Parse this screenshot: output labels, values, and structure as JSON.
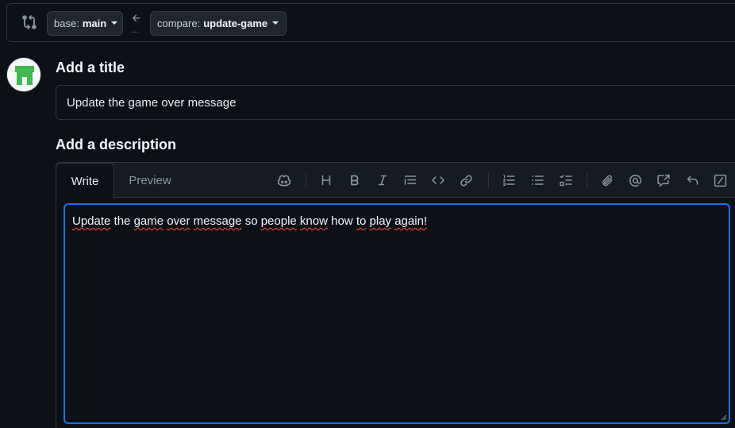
{
  "compare_bar": {
    "icon": "git-compare-icon",
    "base": {
      "key": "base:",
      "value": "main"
    },
    "arrow_icon": "arrow-left-icon",
    "ellipsis": "…",
    "compare": {
      "key": "compare:",
      "value": "update-game"
    }
  },
  "avatar": {
    "icon": "identicon-avatar",
    "color": "#3fb950"
  },
  "title_section": {
    "label": "Add a title",
    "value": "Update the game over message"
  },
  "description_section": {
    "label": "Add a description",
    "tabs": [
      {
        "label": "Write",
        "active": true
      },
      {
        "label": "Preview",
        "active": false
      }
    ],
    "toolbar": [
      "copilot-icon",
      "heading-icon",
      "bold-icon",
      "italic-icon",
      "quote-icon",
      "code-icon",
      "link-icon",
      "numbered-list-icon",
      "unordered-list-icon",
      "task-list-icon",
      "attach-icon",
      "mention-icon",
      "cross-reference-icon",
      "undo-icon",
      "slash-command-icon"
    ],
    "body_words": [
      {
        "text": "Update",
        "misspelled": true
      },
      {
        "text": "the",
        "misspelled": false
      },
      {
        "text": "game",
        "misspelled": true
      },
      {
        "text": "over",
        "misspelled": true
      },
      {
        "text": "message",
        "misspelled": true
      },
      {
        "text": "so",
        "misspelled": false
      },
      {
        "text": "people",
        "misspelled": true
      },
      {
        "text": "know",
        "misspelled": true
      },
      {
        "text": "how",
        "misspelled": false
      },
      {
        "text": "to",
        "misspelled": true
      },
      {
        "text": "play",
        "misspelled": true
      },
      {
        "text": "again!",
        "misspelled": true
      }
    ]
  },
  "colors": {
    "background": "#0d1117",
    "border": "#30363d",
    "focus": "#1f6feb",
    "spellcheck": "#f85149"
  }
}
